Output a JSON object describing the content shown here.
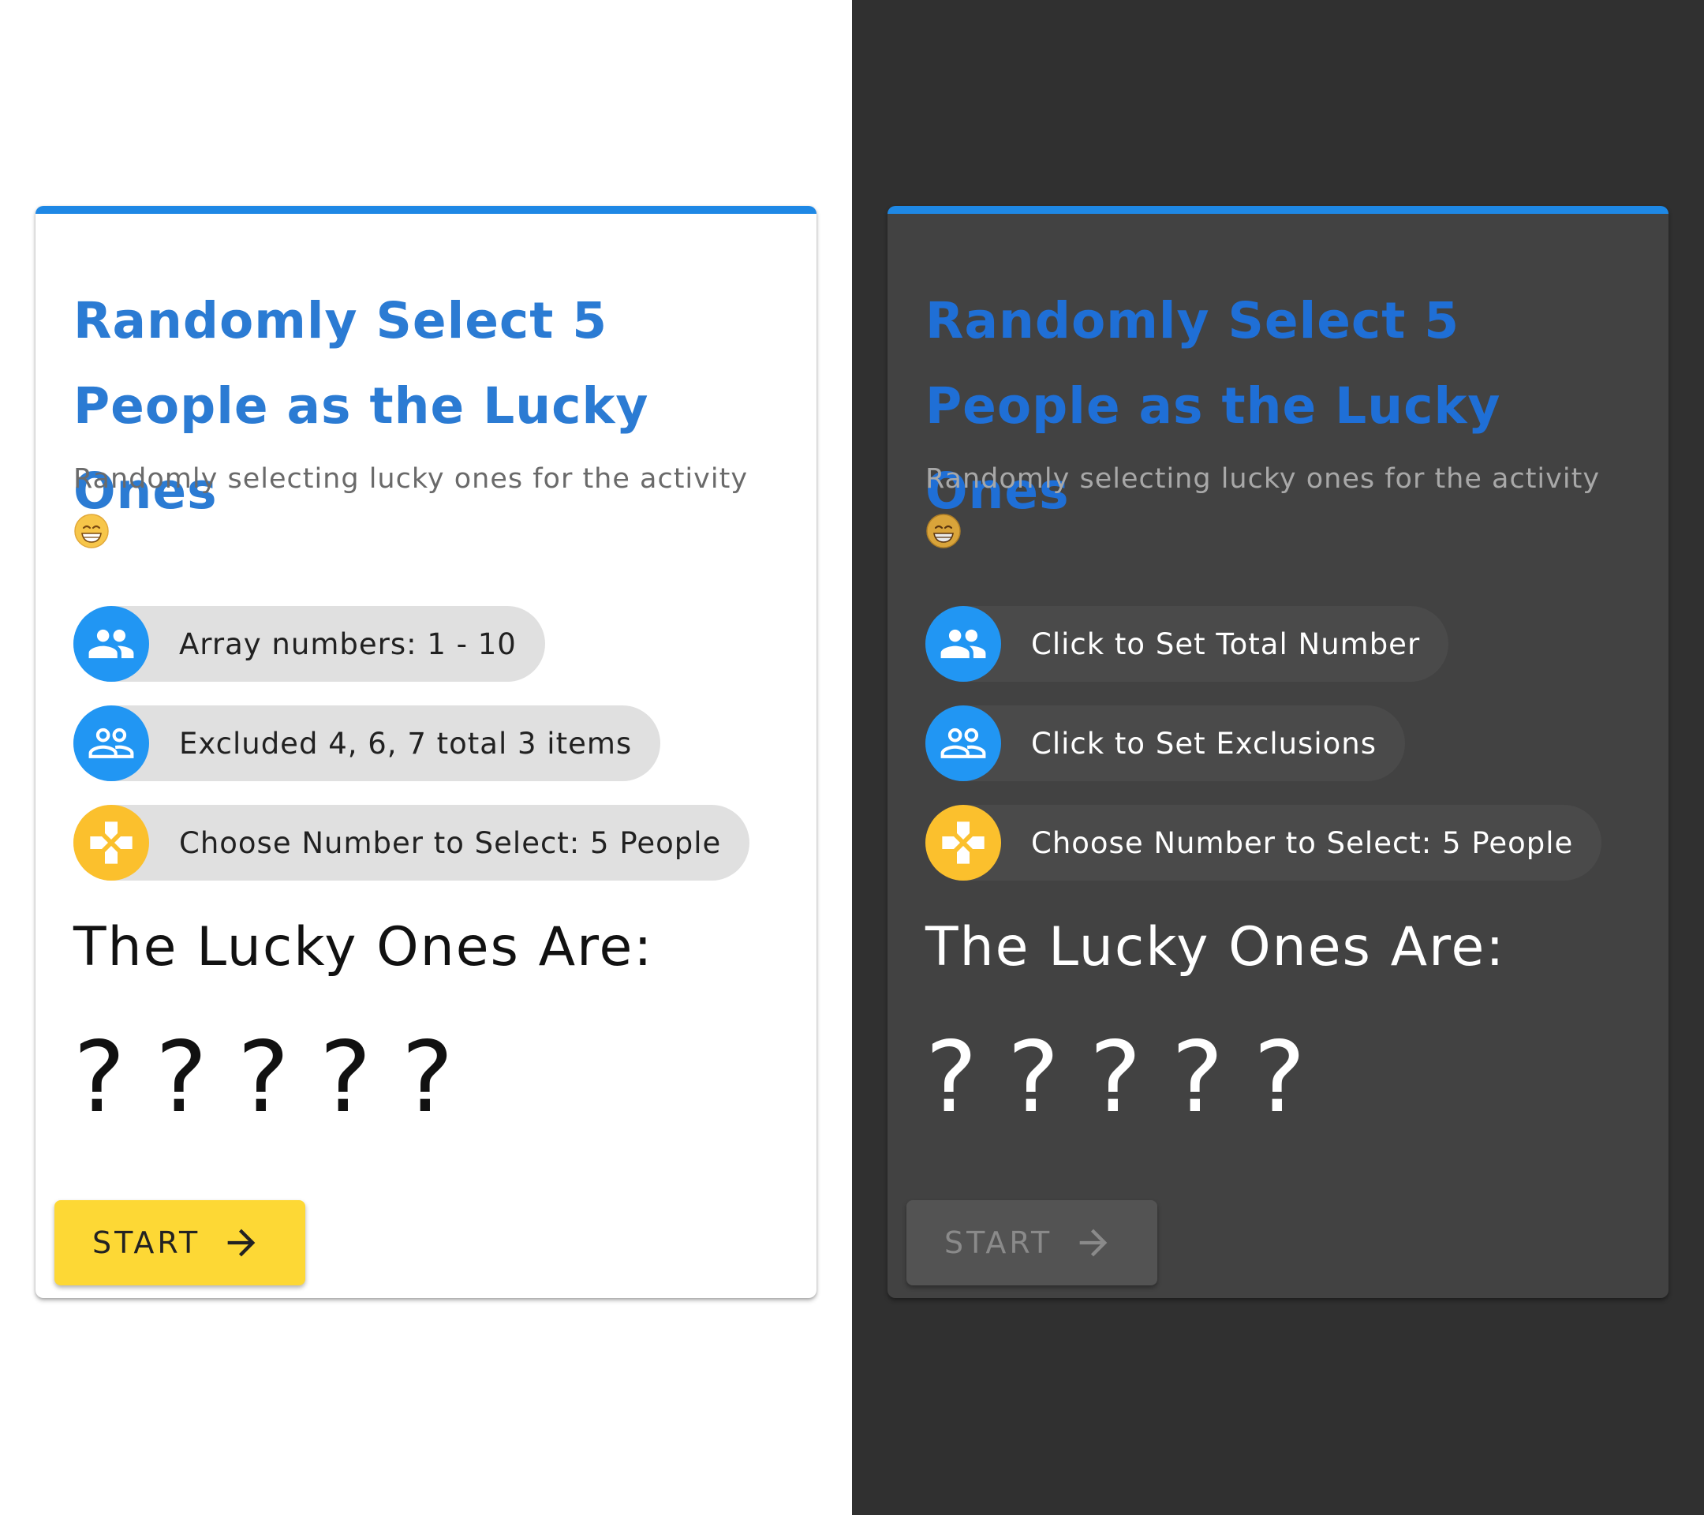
{
  "panels": {
    "light": {
      "theme": "light",
      "title": "Randomly Select 5 People as the Lucky Ones",
      "subtitle": "Randomly selecting lucky ones for the activity",
      "chips": [
        {
          "label": "Array numbers: 1 - 10",
          "icon": "group-icon"
        },
        {
          "label": "Excluded 4, 6, 7 total 3 items",
          "icon": "group-outline-icon"
        },
        {
          "label": "Choose Number to Select: 5 People",
          "icon": "gamepad-icon"
        }
      ],
      "lucky_heading": "The Lucky Ones Are:",
      "results": [
        "?",
        "?",
        "?",
        "?",
        "?"
      ],
      "start_label": "START"
    },
    "dark": {
      "theme": "dark",
      "title": "Randomly Select 5 People as the Lucky Ones",
      "subtitle": "Randomly selecting lucky ones for the activity",
      "chips": [
        {
          "label": "Click to Set Total Number",
          "icon": "group-icon"
        },
        {
          "label": "Click to Set Exclusions",
          "icon": "group-outline-icon"
        },
        {
          "label": "Choose Number to Select: 5 People",
          "icon": "gamepad-icon"
        }
      ],
      "lucky_heading": "The Lucky Ones Are:",
      "results": [
        "?",
        "?",
        "?",
        "?",
        "?"
      ],
      "start_label": "START"
    }
  },
  "colors": {
    "accent_blue": "#1e88e5",
    "title_blue": "#2b7bd3",
    "icon_blue": "#2196f3",
    "icon_yellow": "#fbc02d",
    "start_yellow": "#fdd835",
    "dark_background": "#303030",
    "dark_card": "#424242"
  }
}
